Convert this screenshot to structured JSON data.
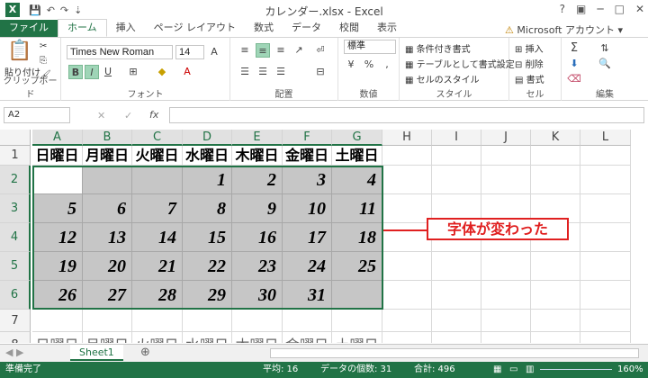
{
  "title": "カレンダー.xlsx - Excel",
  "account": "Microsoft アカウント",
  "tabs": [
    "ファイル",
    "ホーム",
    "挿入",
    "ページ レイアウト",
    "数式",
    "データ",
    "校閲",
    "表示"
  ],
  "ribbon": {
    "clipboard": {
      "label": "クリップボード",
      "paste": "貼り付け"
    },
    "font": {
      "label": "フォント",
      "name": "Times New Roman",
      "size": "14"
    },
    "alignment": {
      "label": "配置"
    },
    "number": {
      "label": "数値",
      "format": "標準"
    },
    "styles": {
      "label": "スタイル",
      "conditional": "条件付き書式",
      "table": "テーブルとして書式設定",
      "cell": "セルのスタイル"
    },
    "cells": {
      "label": "セル",
      "insert": "挿入",
      "delete": "削除",
      "format": "書式"
    },
    "editing": {
      "label": "編集"
    }
  },
  "namebox": "A2",
  "fx": "fx",
  "columns": [
    "A",
    "B",
    "C",
    "D",
    "E",
    "F",
    "G",
    "H",
    "I",
    "J",
    "K",
    "L"
  ],
  "rows": [
    "1",
    "2",
    "3",
    "4",
    "5",
    "6",
    "7",
    "8"
  ],
  "weekdays": [
    "日曜日",
    "月曜日",
    "火曜日",
    "水曜日",
    "木曜日",
    "金曜日",
    "土曜日"
  ],
  "calendar": [
    [
      "",
      "",
      "",
      "1",
      "2",
      "3",
      "4"
    ],
    [
      "5",
      "6",
      "7",
      "8",
      "9",
      "10",
      "11"
    ],
    [
      "12",
      "13",
      "14",
      "15",
      "16",
      "17",
      "18"
    ],
    [
      "19",
      "20",
      "21",
      "22",
      "23",
      "24",
      "25"
    ],
    [
      "26",
      "27",
      "28",
      "29",
      "30",
      "31",
      ""
    ]
  ],
  "callout": "字体が変わった",
  "sheet": "Sheet1",
  "status": {
    "ready": "準備完了",
    "average": "平均: 16",
    "count": "データの個数: 31",
    "sum": "合計: 496",
    "zoom": "160%"
  },
  "colors": {
    "accent": "#217346",
    "selection": "#c6c6c6",
    "callout": "#e02020"
  }
}
